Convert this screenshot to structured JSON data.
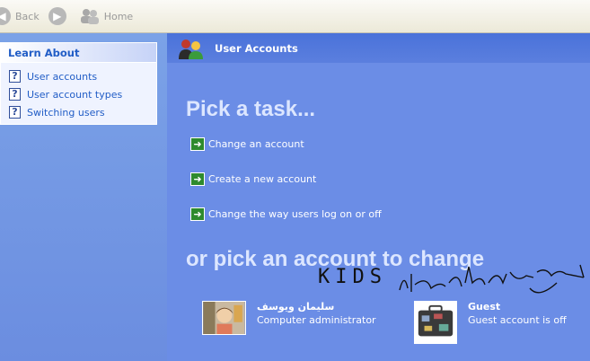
{
  "toolbar": {
    "back_label": "Back",
    "home_label": "Home"
  },
  "learn_about": {
    "title": "Learn About",
    "items": [
      {
        "label": "User accounts"
      },
      {
        "label": "User account types"
      },
      {
        "label": "Switching users"
      }
    ]
  },
  "main": {
    "header_title": "User Accounts",
    "pick_task_heading": "Pick a task...",
    "tasks": [
      {
        "label": "Change an account"
      },
      {
        "label": "Create a new account"
      },
      {
        "label": "Change the way users log on or off"
      }
    ],
    "pick_account_heading": "or pick an account to change",
    "accounts": [
      {
        "name": "سليمان ويوسف",
        "role": "Computer administrator"
      },
      {
        "name": "Guest",
        "role": "Guest account is off"
      }
    ]
  },
  "annotation": {
    "latin_text": "KIDS"
  },
  "colors": {
    "main_bg": "#6b8de6",
    "link": "#215dc6",
    "heading": "#dce6ff",
    "task_arrow": "#2e8a2e"
  }
}
